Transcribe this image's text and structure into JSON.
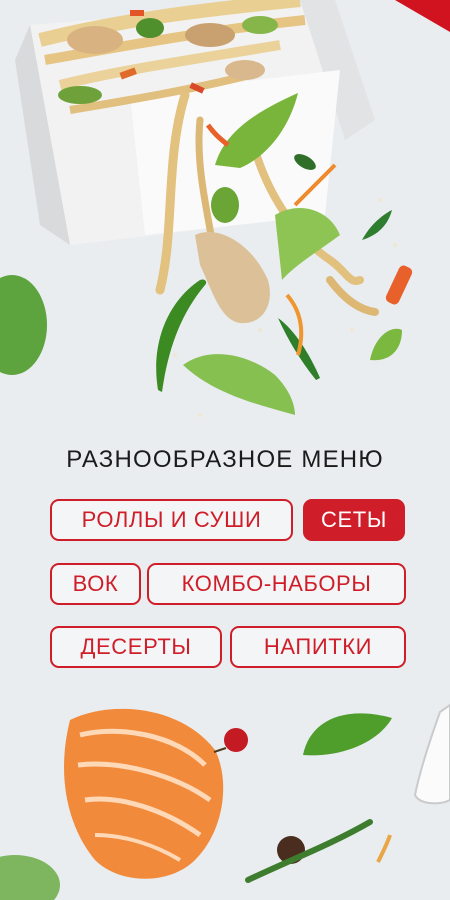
{
  "headline": "РАЗНООБРАЗНОЕ МЕНЮ",
  "categories": {
    "rolls": "РОЛЛЫ И СУШИ",
    "sets": "СЕТЫ",
    "wok": "ВОК",
    "combo": "КОМБО-НАБОРЫ",
    "desserts": "ДЕСЕРТЫ",
    "drinks": "НАПИТКИ"
  },
  "selected_category": "СЕТЫ",
  "colors": {
    "accent": "#cf1e2a",
    "background": "#e9edf0",
    "text": "#1b1b1b"
  }
}
